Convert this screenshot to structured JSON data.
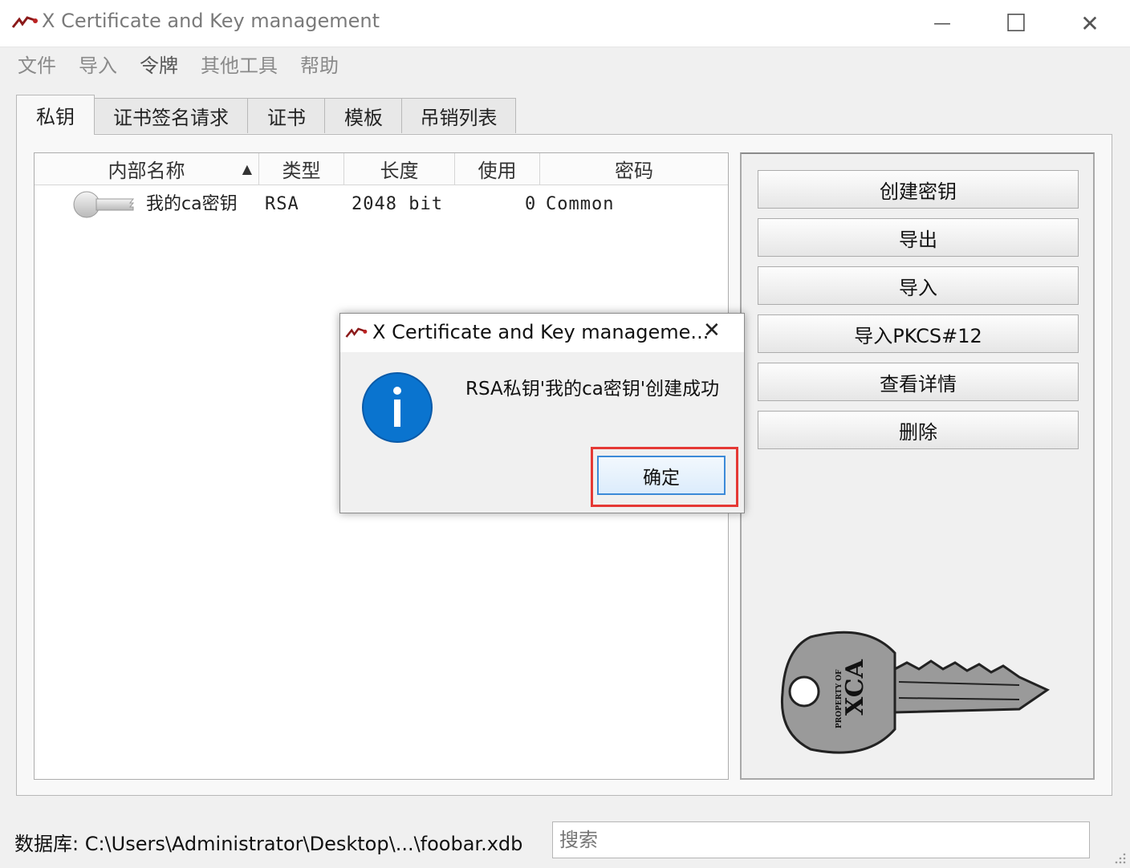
{
  "window": {
    "title": "X Certificate and Key management",
    "minimize_glyph": "—",
    "maximize_glyph": "☐",
    "close_glyph": "✕"
  },
  "menu": [
    "文件",
    "导入",
    "令牌",
    "其他工具",
    "帮助"
  ],
  "tabs": [
    "私钥",
    "证书签名请求",
    "证书",
    "模板",
    "吊销列表"
  ],
  "table": {
    "columns": [
      "内部名称",
      "类型",
      "长度",
      "使用",
      "密码"
    ],
    "sort_indicator": "▲",
    "rows": [
      {
        "name": "我的ca密钥",
        "type": "RSA",
        "length": "2048 bit",
        "use": "0",
        "password": "Common"
      }
    ]
  },
  "side_buttons": [
    "创建密钥",
    "导出",
    "导入",
    "导入PKCS#12",
    "查看详情",
    "删除"
  ],
  "key_image": {
    "text": "XCA",
    "subtext": "PROPERTY OF"
  },
  "status_bar": {
    "database": "数据库: C:\\Users\\Administrator\\Desktop\\...\\foobar.xdb",
    "search_placeholder": "搜索"
  },
  "dialog": {
    "title": "X Certificate and Key manageme...",
    "message": "RSA私钥'我的ca密钥'创建成功",
    "ok_label": "确定",
    "close_glyph": "✕"
  },
  "colors": {
    "info_icon": "#0a74cf",
    "ok_highlight": "#e53935",
    "ok_border": "#3c8ad8"
  }
}
